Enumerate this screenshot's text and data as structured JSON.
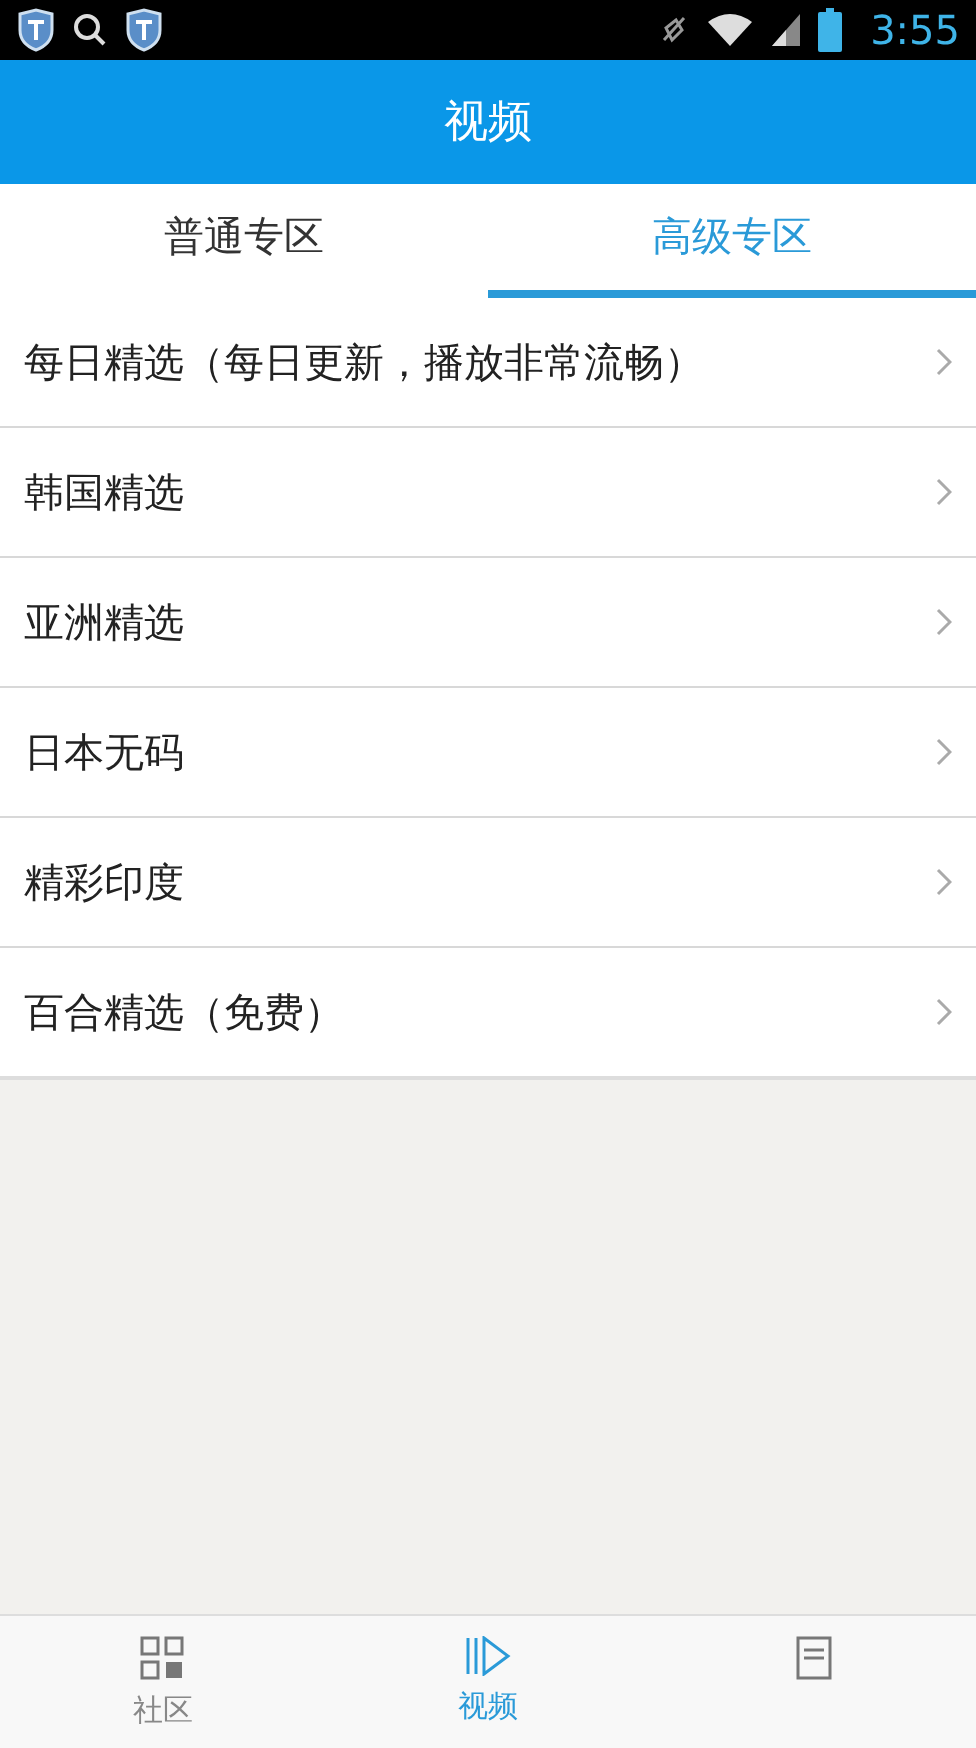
{
  "status_bar": {
    "time": "3:55"
  },
  "header": {
    "title": "视频"
  },
  "tabs": [
    {
      "label": "普通专区",
      "selected": false
    },
    {
      "label": "高级专区",
      "selected": true
    }
  ],
  "list": [
    "每日精选（每日更新，播放非常流畅）",
    "韩国精选",
    "亚洲精选",
    "日本无码",
    "精彩印度",
    "百合精选（免费）"
  ],
  "bottom_nav": [
    {
      "kind": "grid",
      "label": "社区",
      "selected": false
    },
    {
      "kind": "play",
      "label": "视频",
      "selected": true
    },
    {
      "kind": "doc",
      "selected": false
    }
  ]
}
